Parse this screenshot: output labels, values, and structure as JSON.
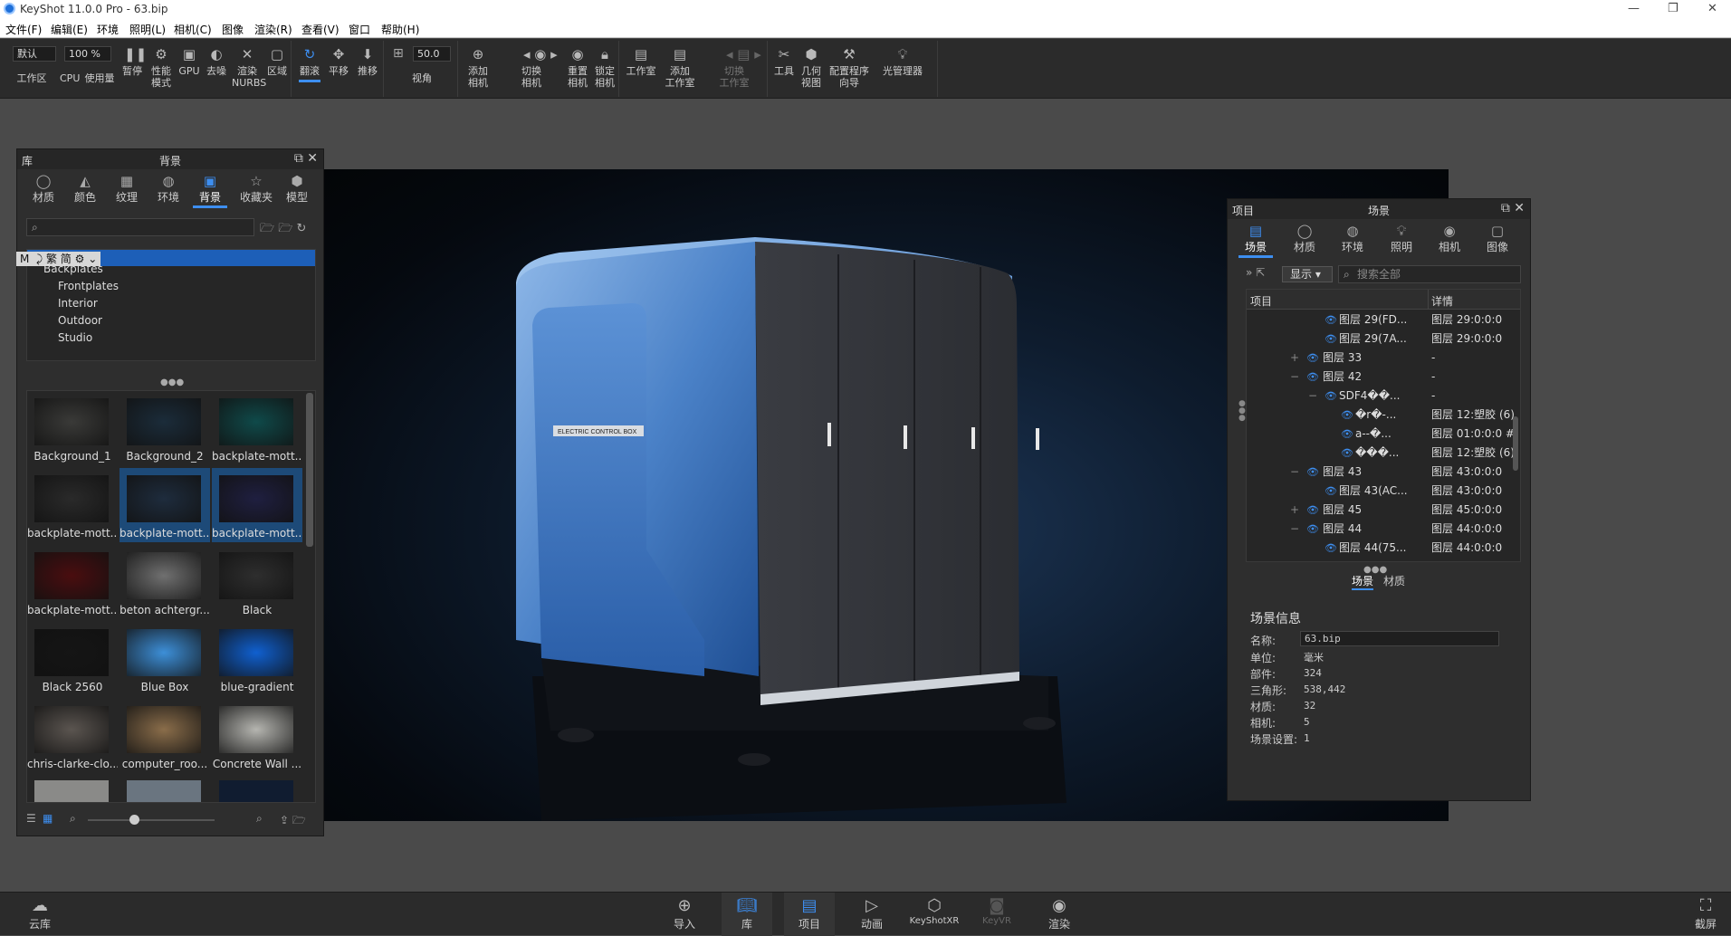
{
  "window": {
    "title": "KeyShot 11.0.0 Pro  - 63.bip",
    "minimize": "—",
    "restore": "❐",
    "close": "✕"
  },
  "menu": [
    "文件(F)",
    "编辑(E)",
    "环境",
    "照明(L)",
    "相机(C)",
    "图像",
    "渲染(R)",
    "查看(V)",
    "窗口",
    "帮助(H)"
  ],
  "toolbar": {
    "preset": "默认",
    "cpu_pct": "100 %",
    "fov": "50.0",
    "buttons": {
      "workspace": "工作区",
      "cpu": "CPU",
      "usage": "使用量",
      "pause": "暂停",
      "perf": "性能\n模式",
      "gpu": "GPU",
      "denoise": "去噪",
      "nurbs": "渲染\nNURBS",
      "region": "区域",
      "tumble": "翻滚",
      "pan": "平移",
      "dolly": "推移",
      "view": "视角",
      "add_camera": "添加\n相机",
      "switch_camera": "切换\n相机",
      "reset_camera": "重置\n相机",
      "lock_camera": "锁定\n相机",
      "studio": "工作室",
      "add_studio": "添加\n工作室",
      "switch_studio": "切换\n工作室",
      "tools": "工具",
      "geometry_view": "几何\n视图",
      "config_wizard": "配置程序\n向导",
      "light_manager": "光管理器"
    }
  },
  "library": {
    "title_left": "库",
    "title": "背景",
    "tabs": [
      "材质",
      "颜色",
      "纹理",
      "环境",
      "背景",
      "收藏夹",
      "模型"
    ],
    "active_tab": "背景",
    "tree_toolbar": "M  ⤸ 繁 简 ⚙ ⌄",
    "tree": [
      "Backplates",
      "Frontplates",
      "Interior",
      "Outdoor",
      "Studio"
    ],
    "thumbs": [
      {
        "name": "Background_1",
        "color": "#3a3a38"
      },
      {
        "name": "Background_2",
        "color": "#1b2c3a"
      },
      {
        "name": "backplate-mott...",
        "color": "#0f4a4a"
      },
      {
        "name": "backplate-mott...",
        "color": "#2a2a2a"
      },
      {
        "name": "backplate-mott...",
        "color": "#1e2c3d"
      },
      {
        "name": "backplate-mott...",
        "color": "#1f1f40"
      },
      {
        "name": "backplate-mott...",
        "color": "#4a0d0f"
      },
      {
        "name": "beton achtergr...",
        "color": "#707070"
      },
      {
        "name": "Black",
        "color": "#2e2e2e"
      },
      {
        "name": "Black 2560",
        "color": "#151515"
      },
      {
        "name": "Blue Box",
        "color": "#3d8fd8"
      },
      {
        "name": "blue-gradient",
        "color": "#1060d0"
      },
      {
        "name": "chris-clarke-clo...",
        "color": "#5b5550"
      },
      {
        "name": "computer_roo...",
        "color": "#8a6d4a"
      },
      {
        "name": "Concrete Wall ...",
        "color": "#b5b5b0"
      }
    ]
  },
  "project": {
    "title_left": "项目",
    "title": "场景",
    "tabs": [
      "场景",
      "材质",
      "环境",
      "照明",
      "相机",
      "图像"
    ],
    "active_tab": "场景",
    "display_btn": "显示",
    "search_placeholder": "搜索全部",
    "col_item": "项目",
    "col_detail": "详情",
    "rows": [
      {
        "name": "图层 29(FD...",
        "detail": "图层 29:0:0:0"
      },
      {
        "name": "图层 29(7A...",
        "detail": "图层 29:0:0:0"
      },
      {
        "name": "图层 33",
        "detail": "-"
      },
      {
        "name": "图层 42",
        "detail": "-"
      },
      {
        "name": "SDF4��...",
        "detail": "-"
      },
      {
        "name": "�r�-...",
        "detail": "图层 12:塑胶 (6)"
      },
      {
        "name": "a--�...",
        "detail": "图层 01:0:0:0 #1"
      },
      {
        "name": "���...",
        "detail": "图层 12:塑胶 (6)"
      },
      {
        "name": "图层 43",
        "detail": "图层 43:0:0:0"
      },
      {
        "name": "图层 43(AC...",
        "detail": "图层 43:0:0:0"
      },
      {
        "name": "图层 45",
        "detail": "图层 45:0:0:0"
      },
      {
        "name": "图层 44",
        "detail": "图层 44:0:0:0"
      },
      {
        "name": "图层 44(75...",
        "detail": "图层 44:0:0:0"
      }
    ],
    "subtabs": [
      "场景",
      "材质"
    ],
    "info_title": "场景信息",
    "info": [
      {
        "label": "名称:",
        "value": "63.bip"
      },
      {
        "label": "单位:",
        "value": "毫米"
      },
      {
        "label": "部件:",
        "value": "324"
      },
      {
        "label": "三角形:",
        "value": "538,442"
      },
      {
        "label": "材质:",
        "value": "32"
      },
      {
        "label": "相机:",
        "value": "5"
      },
      {
        "label": "场景设置:",
        "value": "1"
      }
    ]
  },
  "scene": {
    "label_text": "ELECTRIC CONTROL BOX"
  },
  "bottom": {
    "cloud": "云库",
    "import": "导入",
    "library": "库",
    "project": "项目",
    "animation": "动画",
    "keyshotxr": "KeyShotXR",
    "keyvr": "KeyVR",
    "render": "渲染",
    "screenshot": "截屏"
  },
  "colors": {
    "accent": "#3d8ef0",
    "panel": "#2e2e2e",
    "selection": "#1d4a78"
  }
}
